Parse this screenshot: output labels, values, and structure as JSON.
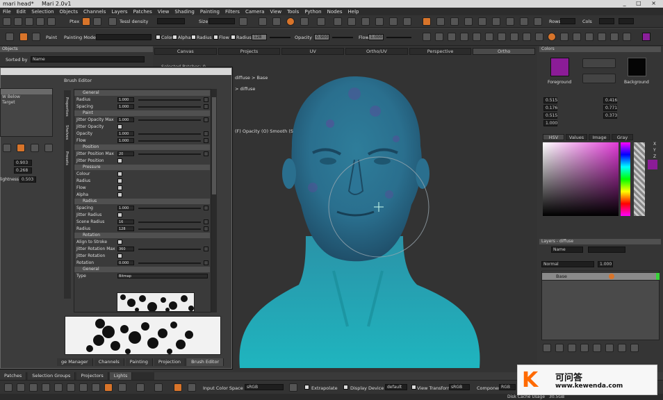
{
  "window": {
    "doc_title": "mari head*",
    "app_title": "Mari 2.0v1",
    "controls": "_ □ ×"
  },
  "menu": [
    "File",
    "Edit",
    "Selection",
    "Objects",
    "Channels",
    "Layers",
    "Patches",
    "View",
    "Shading",
    "Painting",
    "Filters",
    "Camera",
    "View",
    "Tools",
    "Python",
    "Nodes",
    "Help"
  ],
  "toolbar1": {
    "paint_label": "Ptex",
    "tessellation_label": "Tessl density",
    "size_label": "Size",
    "rows_label": "Rows",
    "cols_label": "Cols"
  },
  "toolbar2": {
    "paint_label": "Paint",
    "painting_mode_label": "Painting Mode",
    "color_label": "Color",
    "alpha_label": "Alpha",
    "radius_label": "Radius",
    "flow_label": "Flow",
    "radius_value": "128",
    "opacity_label": "Opacity",
    "opacity_value": "0.900",
    "flow2_label": "Flow",
    "flow_value": "1.000"
  },
  "left_panel": {
    "title": "Objects",
    "sorted_by_label": "Sorted by",
    "sorted_by_value": "Name",
    "items": [
      "W Below",
      "Target"
    ],
    "fields": [
      "0.903",
      "0.268",
      "0.503"
    ],
    "field_label": "lightness"
  },
  "viewport_tabs": [
    {
      "label": "Canvas",
      "selected": false
    },
    {
      "label": "Projects",
      "selected": false
    },
    {
      "label": "UV",
      "selected": false
    },
    {
      "label": "Ortho/UV",
      "selected": false
    },
    {
      "label": "Perspective",
      "selected": false
    },
    {
      "label": "Ortho",
      "selected": true
    }
  ],
  "viewport": {
    "breadcrumb": "diffuse > Base",
    "breadcrumb2": "> diffuse",
    "hint": "(F)  Opacity (O)  Smooth (S)",
    "selected_label": "Selected Patches: 0"
  },
  "brush_editor": {
    "title": "Brush Editor",
    "side_tabs": [
      "Properties",
      "Shelves",
      "Presets"
    ],
    "sections": [
      {
        "name": "General",
        "rows": [
          {
            "label": "Radius",
            "value": "1.000",
            "kind": "slider"
          },
          {
            "label": "Spacing",
            "value": "1.000",
            "kind": "slider"
          }
        ]
      },
      {
        "name": "Paint",
        "rows": [
          {
            "label": "Jitter Opacity Max",
            "value": "1.000",
            "kind": "slider"
          },
          {
            "label": "Jitter Opacity",
            "kind": "check"
          },
          {
            "label": "Opacity",
            "value": "1.000",
            "kind": "slider"
          },
          {
            "label": "Flow",
            "value": "1.000",
            "kind": "slider"
          }
        ]
      },
      {
        "name": "Position",
        "rows": [
          {
            "label": "Jitter Position Max",
            "value": "20",
            "kind": "slider"
          },
          {
            "label": "Jitter Position",
            "kind": "check"
          }
        ]
      },
      {
        "name": "Pressure",
        "rows": [
          {
            "label": "Colour",
            "kind": "check"
          },
          {
            "label": "Radius",
            "kind": "check"
          },
          {
            "label": "Flow",
            "kind": "check"
          },
          {
            "label": "Alpha",
            "kind": "check"
          }
        ]
      },
      {
        "name": "Radius",
        "rows": [
          {
            "label": "Spacing",
            "value": "1.000",
            "kind": "slider"
          },
          {
            "label": "Jitter Radius",
            "kind": "check"
          },
          {
            "label": "Scene Radius",
            "value": "16",
            "kind": "slider"
          },
          {
            "label": "Radius",
            "value": "128",
            "kind": "slider"
          }
        ]
      },
      {
        "name": "Rotation",
        "rows": [
          {
            "label": "Align to Stroke",
            "kind": "check"
          },
          {
            "label": "Jitter Rotation Max",
            "value": "360",
            "kind": "slider"
          },
          {
            "label": "Jitter Rotation",
            "kind": "check"
          },
          {
            "label": "Rotation",
            "value": "0.000",
            "kind": "slider"
          }
        ]
      },
      {
        "name": "General",
        "rows": [
          {
            "label": "Type",
            "value": "Bitmap",
            "kind": "select"
          }
        ]
      }
    ],
    "bottom_tabs": [
      "ge Manager",
      "Channels",
      "Painting",
      "Projection",
      "Brush Editor"
    ]
  },
  "colors_panel": {
    "title": "Colors",
    "fg_label": "Foreground",
    "bg_label": "Background",
    "fg_color": "#8b1c97",
    "bg_color": "#050505",
    "values_left": [
      "0.515",
      "0.176",
      "0.515",
      "1.000"
    ],
    "values_right": [
      "0.416",
      "0.771",
      "0.373"
    ],
    "tabs": [
      "HSV",
      "Values",
      "Image",
      "Gray"
    ],
    "side_letters": [
      "X",
      "Y",
      "Z"
    ]
  },
  "layers_panel": {
    "title": "Layers - diffuse",
    "filter_value": "Name",
    "blend_mode": "Normal",
    "opacity": "1.000",
    "layer_name": "Base"
  },
  "bottom_tabs": [
    "Patches",
    "Selection Groups",
    "Projectors",
    "Lights"
  ],
  "bottom_bar": {
    "input_color_space_label": "Input Color Space",
    "input_color_space": "sRGB",
    "extrapolate_label": "Extrapolate",
    "display_device_label": "Display Device",
    "display_device": "default",
    "view_transform_label": "View Transform",
    "view_transform": "sRGB",
    "component_label": "Component",
    "component_value": "RGB"
  },
  "status": {
    "cache": "Disk Cache Usage",
    "ram": "30.5GB"
  },
  "watermark": {
    "logo": "K",
    "title": "可问答",
    "url": "www.kewenda.com"
  }
}
